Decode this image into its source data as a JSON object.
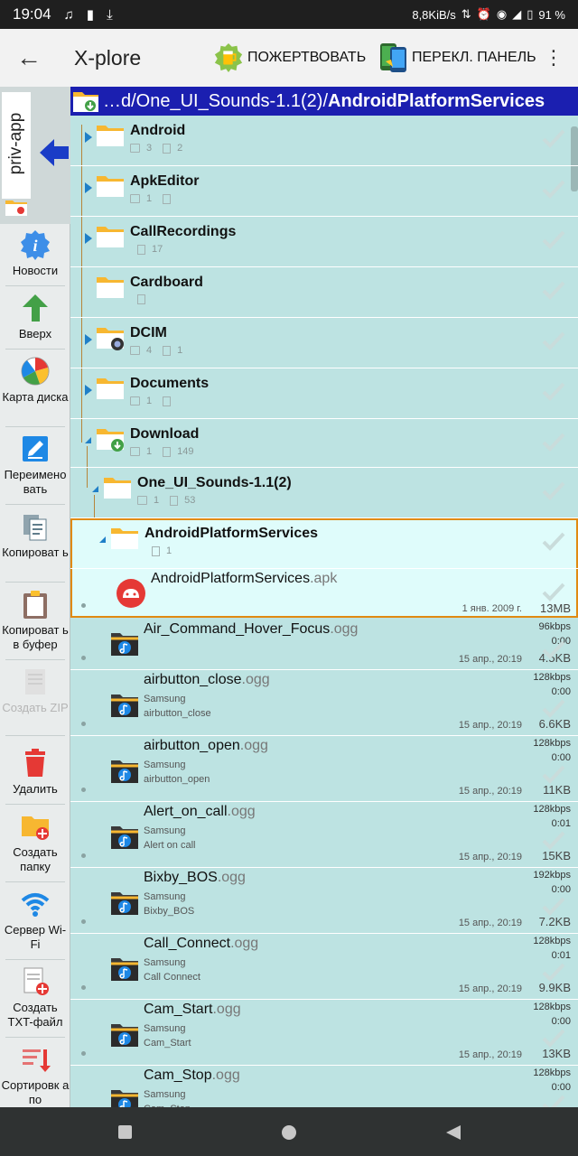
{
  "status": {
    "time": "19:04",
    "net_speed": "8,8KiB/s",
    "battery": "91 %"
  },
  "appbar": {
    "title": "X-plore",
    "donate": "ПОЖЕРТВОВАТЬ",
    "switch_panel": "ПЕРЕКЛ. ПАНЕЛЬ"
  },
  "pane": {
    "label": "priv-app"
  },
  "toolbar": [
    {
      "label": "Новости",
      "icon": "info-icon",
      "enabled": true
    },
    {
      "label": "Вверх",
      "icon": "arrow-up-icon",
      "enabled": true
    },
    {
      "label": "Карта диска",
      "icon": "disk-map-icon",
      "enabled": true
    },
    {
      "label": "Переимено вать",
      "icon": "rename-icon",
      "enabled": true
    },
    {
      "label": "Копироват ь",
      "icon": "copy-icon",
      "enabled": true
    },
    {
      "label": "Копироват ь в буфер",
      "icon": "clipboard-icon",
      "enabled": true
    },
    {
      "label": "Создать ZIP",
      "icon": "zip-icon",
      "enabled": false
    },
    {
      "label": "Удалить",
      "icon": "trash-icon",
      "enabled": true
    },
    {
      "label": "Создать папку",
      "icon": "new-folder-icon",
      "enabled": true
    },
    {
      "label": "Сервер Wi-Fi",
      "icon": "wifi-icon",
      "enabled": true
    },
    {
      "label": "Создать TXT-файл",
      "icon": "new-txt-icon",
      "enabled": true
    },
    {
      "label": "Сортировк а по",
      "icon": "sort-icon",
      "enabled": true
    }
  ],
  "path": {
    "prefix": "…d/One_UI_Sounds-1.1(2)/",
    "current": "AndroidPlatformServices"
  },
  "folders": [
    {
      "name": "Android",
      "dirs": "3",
      "files": "2"
    },
    {
      "name": "ApkEditor",
      "dirs": "1",
      "files": ""
    },
    {
      "name": "CallRecordings",
      "dirs": "",
      "files": "17"
    },
    {
      "name": "Cardboard",
      "dirs": "",
      "files": ""
    },
    {
      "name": "DCIM",
      "dirs": "4",
      "files": "1"
    },
    {
      "name": "Documents",
      "dirs": "1",
      "files": ""
    },
    {
      "name": "Download",
      "dirs": "1",
      "files": "149"
    },
    {
      "name": "One_UI_Sounds-1.1(2)",
      "dirs": "1",
      "files": "53"
    },
    {
      "name": "AndroidPlatformServices",
      "dirs": "",
      "files": "1"
    }
  ],
  "apk": {
    "name": "AndroidPlatformServices",
    "ext": ".apk",
    "date": "1 янв. 2009 г.",
    "size": "13MB"
  },
  "audio": [
    {
      "name": "Air_Command_Hover_Focus",
      "ext": ".ogg",
      "artist": "",
      "title": "",
      "bitrate": "96kbps",
      "duration": "0:00",
      "date": "15 апр., 20:19",
      "size": "4.5KB"
    },
    {
      "name": "airbutton_close",
      "ext": ".ogg",
      "artist": "Samsung",
      "title": "airbutton_close",
      "bitrate": "128kbps",
      "duration": "0:00",
      "date": "15 апр., 20:19",
      "size": "6.6KB"
    },
    {
      "name": "airbutton_open",
      "ext": ".ogg",
      "artist": "Samsung",
      "title": "airbutton_open",
      "bitrate": "128kbps",
      "duration": "0:00",
      "date": "15 апр., 20:19",
      "size": "11KB"
    },
    {
      "name": "Alert_on_call",
      "ext": ".ogg",
      "artist": "Samsung",
      "title": "Alert on call",
      "bitrate": "128kbps",
      "duration": "0:01",
      "date": "15 апр., 20:19",
      "size": "15KB"
    },
    {
      "name": "Bixby_BOS",
      "ext": ".ogg",
      "artist": "Samsung",
      "title": "Bixby_BOS",
      "bitrate": "192kbps",
      "duration": "0:00",
      "date": "15 апр., 20:19",
      "size": "7.2KB"
    },
    {
      "name": "Call_Connect",
      "ext": ".ogg",
      "artist": "Samsung",
      "title": "Call Connect",
      "bitrate": "128kbps",
      "duration": "0:01",
      "date": "15 апр., 20:19",
      "size": "9.9KB"
    },
    {
      "name": "Cam_Start",
      "ext": ".ogg",
      "artist": "Samsung",
      "title": "Cam_Start",
      "bitrate": "128kbps",
      "duration": "0:00",
      "date": "15 апр., 20:19",
      "size": "13KB"
    },
    {
      "name": "Cam_Stop",
      "ext": ".ogg",
      "artist": "Samsung",
      "title": "Cam_Stop",
      "bitrate": "128kbps",
      "duration": "0:00",
      "date": "",
      "size": ""
    }
  ]
}
